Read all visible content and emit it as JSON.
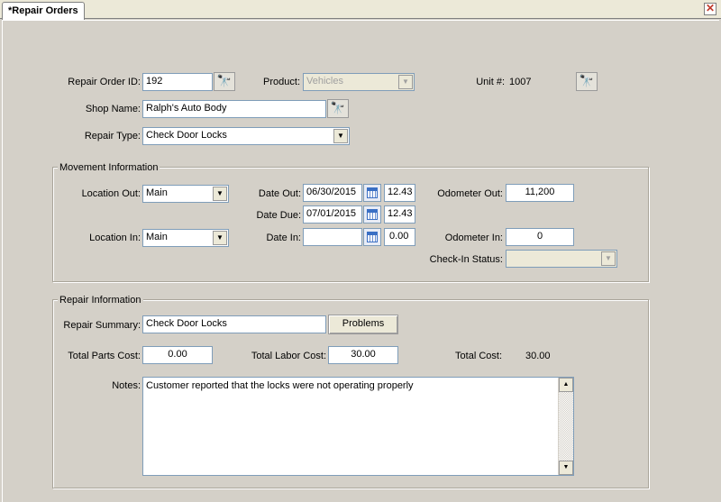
{
  "window": {
    "tab_title": "*Repair Orders"
  },
  "header": {
    "repair_order_label": "Repair Order ID:",
    "repair_order_value": "192",
    "product_label": "Product:",
    "product_value": "Vehicles",
    "unit_label": "Unit #:",
    "unit_value": "1007",
    "shop_name_label": "Shop Name:",
    "shop_name_value": "Ralph's Auto Body",
    "repair_type_label": "Repair Type:",
    "repair_type_value": "Check Door Locks"
  },
  "movement": {
    "title": "Movement Information",
    "location_out_label": "Location Out:",
    "location_out_value": "Main",
    "date_out_label": "Date Out:",
    "date_out_value": "06/30/2015",
    "time_out_value": "12.43",
    "odometer_out_label": "Odometer Out:",
    "odometer_out_value": "11,200",
    "date_due_label": "Date Due:",
    "date_due_value": "07/01/2015",
    "time_due_value": "12.43",
    "location_in_label": "Location In:",
    "location_in_value": "Main",
    "date_in_label": "Date In:",
    "date_in_value": "",
    "time_in_value": "0.00",
    "odometer_in_label": "Odometer In:",
    "odometer_in_value": "0",
    "checkin_status_label": "Check-In Status:",
    "checkin_status_value": ""
  },
  "repair": {
    "title": "Repair Information",
    "summary_label": "Repair Summary:",
    "summary_value": "Check Door Locks",
    "problems_button": "Problems",
    "parts_cost_label": "Total Parts Cost:",
    "parts_cost_value": "0.00",
    "labor_cost_label": "Total Labor Cost:",
    "labor_cost_value": "30.00",
    "total_cost_label": "Total Cost:",
    "total_cost_value": "30.00",
    "notes_label": "Notes:",
    "notes_value": "Customer reported that the locks were not operating properly"
  },
  "icons": {
    "lookup": "binoculars-icon",
    "calendar": "calendar-icon",
    "dropdown": "chevron-down-icon",
    "close": "close-icon"
  }
}
